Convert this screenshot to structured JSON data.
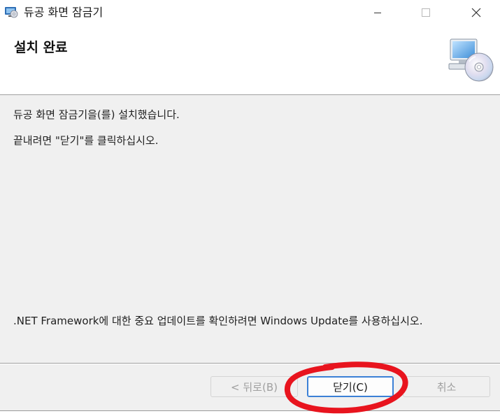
{
  "window": {
    "title": "듀공 화면 잠금기"
  },
  "banner": {
    "title": "설치 완료"
  },
  "body": {
    "line1": "듀공 화면 잠금기을(를) 설치했습니다.",
    "line2": "끝내려면 \"닫기\"를 클릭하십시오.",
    "footnote": ".NET Framework에 대한 중요 업데이트를 확인하려면 Windows Update를 사용하십시오."
  },
  "buttons": {
    "back": "< 뒤로(B)",
    "close": "닫기(C)",
    "cancel": "취소"
  },
  "state": {
    "back_enabled": false,
    "cancel_enabled": false,
    "focused_button": "close"
  },
  "colors": {
    "annotation": "#e8141e",
    "focus_border": "#3b80d6"
  },
  "icons": {
    "app": "installer-cd-icon",
    "banner": "computer-cd-icon"
  }
}
